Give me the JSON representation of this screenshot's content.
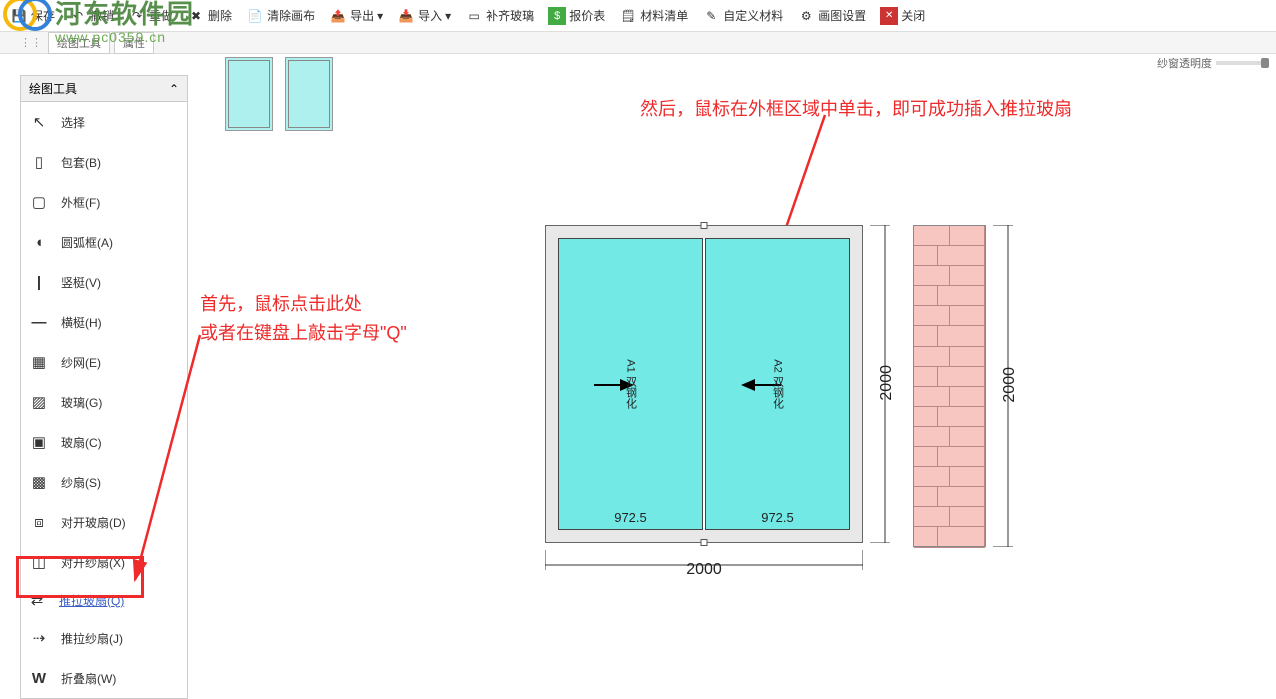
{
  "watermark": {
    "text1": "河东软件园",
    "text2": "www.pc0359.cn"
  },
  "toolbar": [
    {
      "id": "save",
      "label": "保存"
    },
    {
      "id": "undo",
      "label": "撤销"
    },
    {
      "id": "redo",
      "label": "重做"
    },
    {
      "id": "delete",
      "label": "删除"
    },
    {
      "id": "clear",
      "label": "清除画布"
    },
    {
      "id": "export",
      "label": "导出"
    },
    {
      "id": "import",
      "label": "导入"
    },
    {
      "id": "align-glass",
      "label": "补齐玻璃"
    },
    {
      "id": "quote",
      "label": "报价表"
    },
    {
      "id": "bom",
      "label": "材料清单"
    },
    {
      "id": "custom-material",
      "label": "自定义材料"
    },
    {
      "id": "canvas-settings",
      "label": "画图设置"
    },
    {
      "id": "close",
      "label": "关闭"
    }
  ],
  "secbar": {
    "tab1": "绘图工具",
    "tab2": "属性"
  },
  "tool_panel": {
    "header": "绘图工具",
    "items": [
      {
        "id": "select",
        "label": "选择"
      },
      {
        "id": "frame-b",
        "label": "包套(B)"
      },
      {
        "id": "outer-f",
        "label": "外框(F)"
      },
      {
        "id": "arc-a",
        "label": "圆弧框(A)"
      },
      {
        "id": "vert-v",
        "label": "竖梃(V)"
      },
      {
        "id": "horz-h",
        "label": "横梃(H)"
      },
      {
        "id": "mesh-e",
        "label": "纱网(E)"
      },
      {
        "id": "glass-g",
        "label": "玻璃(G)"
      },
      {
        "id": "sash-c",
        "label": "玻扇(C)"
      },
      {
        "id": "screen-s",
        "label": "纱扇(S)"
      },
      {
        "id": "open-glass-d",
        "label": "对开玻扇(D)"
      },
      {
        "id": "open-screen-x",
        "label": "对开纱扇(X)"
      },
      {
        "id": "slide-glass-q",
        "label": "推拉玻扇(Q)"
      },
      {
        "id": "slide-screen-j",
        "label": "推拉纱扇(J)"
      },
      {
        "id": "fold-w",
        "label": "折叠扇(W)"
      }
    ]
  },
  "annotations": {
    "left": "首先，鼠标点击此处\n或者在键盘上敲击字母\"Q\"",
    "right": "然后，鼠标在外框区域中单击，即可成功插入推拉玻扇"
  },
  "transparency_label": "纱窗透明度",
  "drawing": {
    "pane_left_label": "A1 双钢化",
    "pane_right_label": "A2 双钢化",
    "dim_bottom": "2000",
    "dim_right": "2000",
    "dim_inner_left": "972.5",
    "dim_inner_right": "972.5",
    "dim_wall": "2000"
  }
}
